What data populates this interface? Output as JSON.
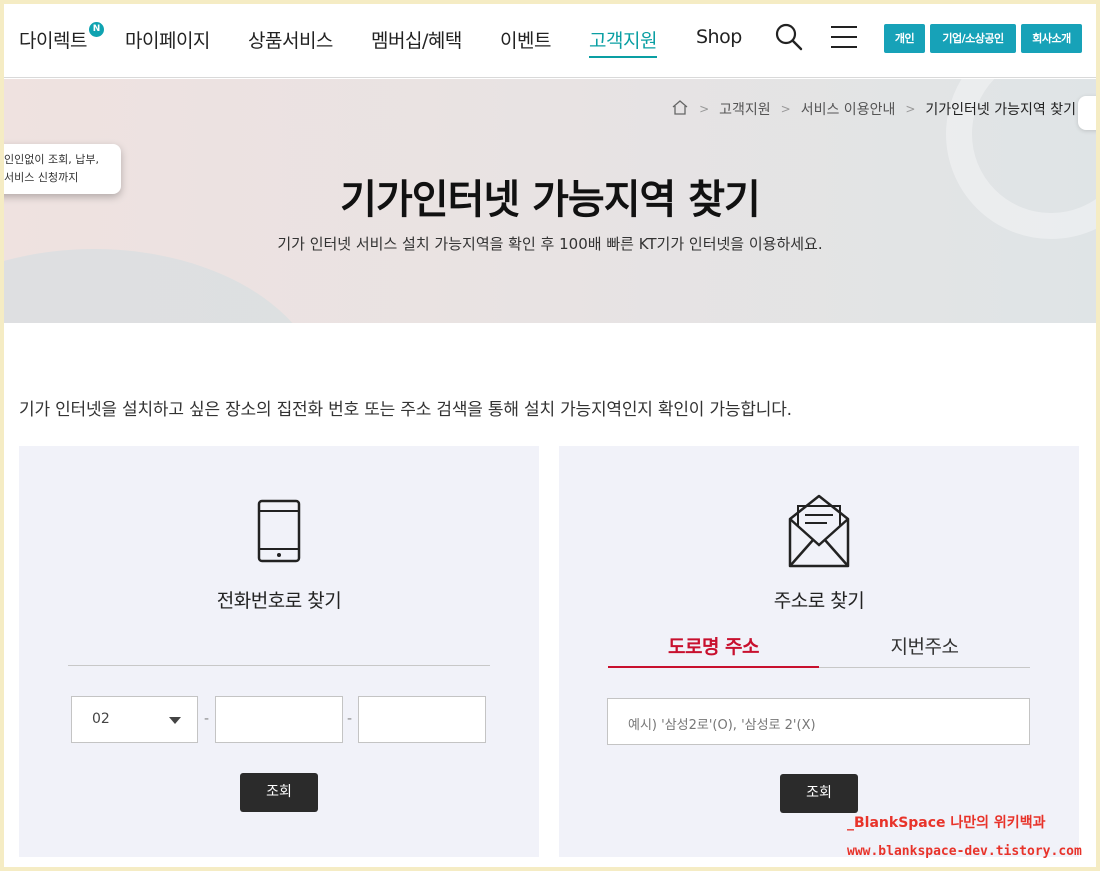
{
  "header": {
    "brand": "다이렉트",
    "brand_badge": "N",
    "nav": [
      "마이페이지",
      "상품서비스",
      "멤버십/혜택",
      "이벤트",
      "고객지원",
      "Shop"
    ],
    "active_nav": "고객지원",
    "buttons": [
      "개인",
      "기업/소상공인",
      "회사소개"
    ]
  },
  "breadcrumb": {
    "items": [
      "고객지원",
      "서비스 이용안내",
      "기가인터넷 가능지역 찾기"
    ]
  },
  "tooltip": {
    "line1": "인인없이 조회, 납부,",
    "line2": "서비스 신청까지"
  },
  "hero": {
    "title": "기가인터넷 가능지역 찾기",
    "subtitle": "기가 인터넷 서비스 설치 가능지역을 확인 후 100배 빠른 KT기가 인터넷을 이용하세요."
  },
  "intro": "기가 인터넷을 설치하고 싶은 장소의 집전화 번호 또는 주소 검색을 통해 설치 가능지역인지 확인이 가능합니다.",
  "phone_panel": {
    "title": "전화번호로 찾기",
    "area_code": "02",
    "dash": "-",
    "submit": "조회"
  },
  "address_panel": {
    "title": "주소로 찾기",
    "tabs": [
      "도로명 주소",
      "지번주소"
    ],
    "active_tab": "도로명 주소",
    "placeholder": "예시) '삼성2로'(O), '삼성로 2'(X)",
    "submit": "조회"
  },
  "watermark": {
    "line1": "_BlankSpace 나만의 위키백과",
    "line2": "www.blankspace-dev.tistory.com"
  },
  "colors": {
    "accent": "#0a9fa3",
    "header_button": "#17a2b8",
    "tab_active": "#c8102e",
    "panel_bg": "#f1f2f9",
    "submit_bg": "#2b2b2b",
    "frame": "#f5ecc4"
  },
  "icons": [
    "search-icon",
    "menu-icon",
    "home-icon",
    "mobile-phone-icon",
    "envelope-icon",
    "dropdown-caret-icon"
  ]
}
